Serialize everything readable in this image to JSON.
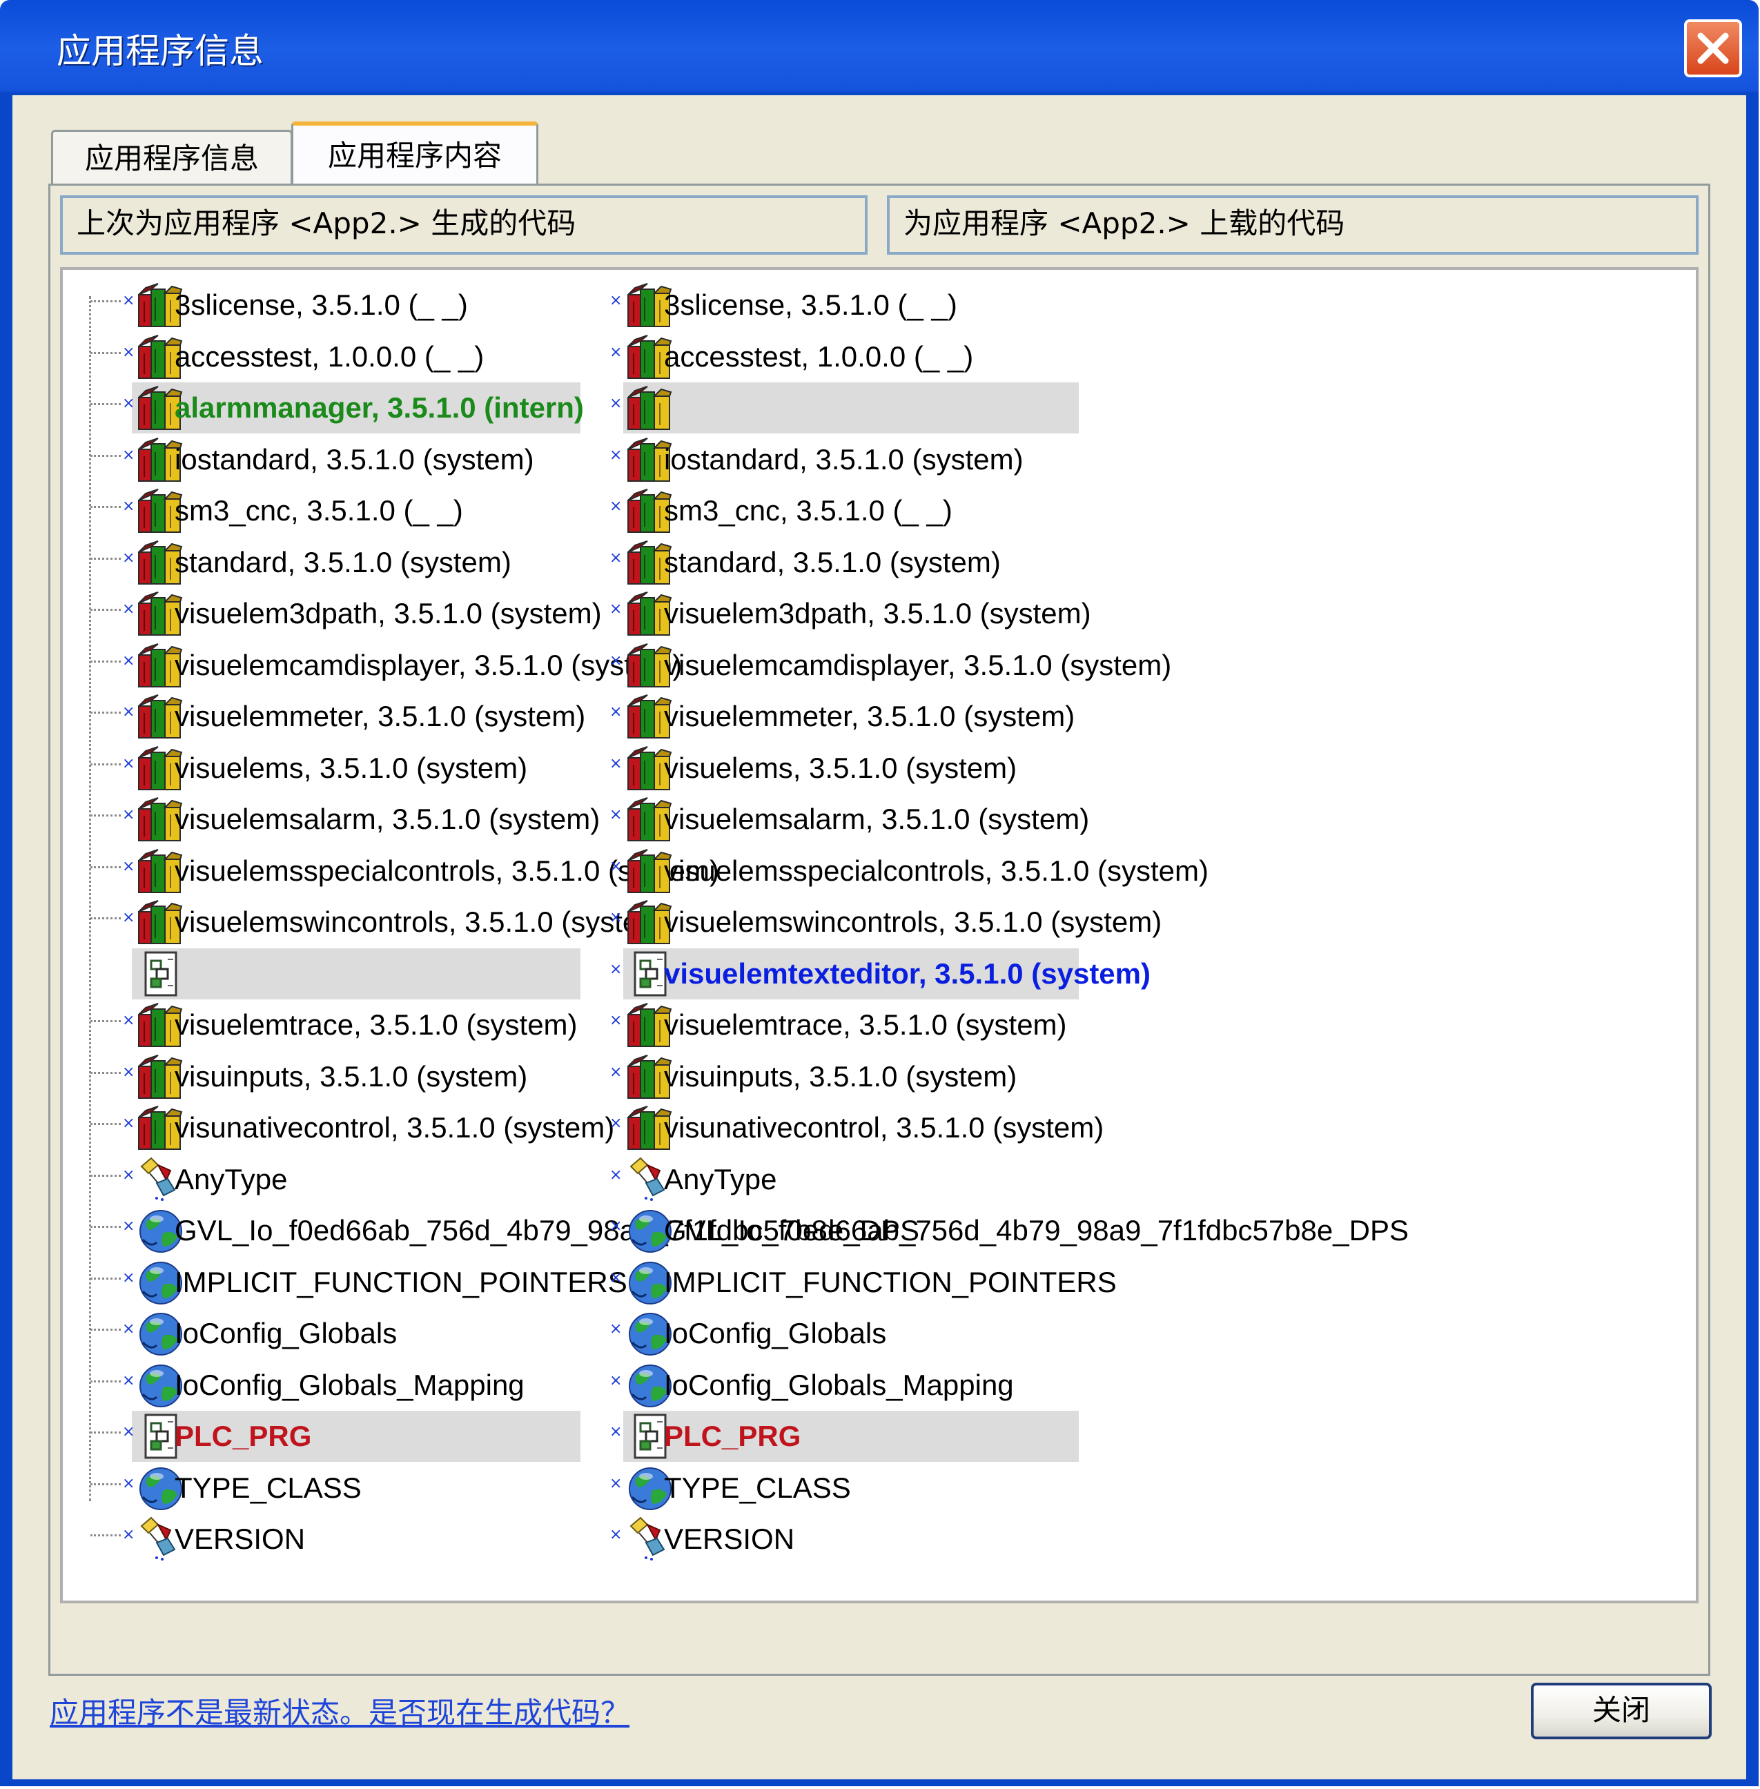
{
  "window": {
    "title": "应用程序信息"
  },
  "tabs": [
    {
      "label": "应用程序信息",
      "active": false
    },
    {
      "label": "应用程序内容",
      "active": true
    }
  ],
  "columns": {
    "left_header": "上次为应用程序 <App2.> 生成的代码",
    "right_header": "为应用程序 <App2.> 上载的代码"
  },
  "rows": [
    {
      "icon": "library-icon",
      "left": "3slicense, 3.5.1.0 (_ _)",
      "right": "3slicense, 3.5.1.0 (_ _)",
      "style": "normal",
      "hl": false
    },
    {
      "icon": "library-icon",
      "left": "accesstest, 1.0.0.0 (_ _)",
      "right": "accesstest, 1.0.0.0 (_ _)",
      "style": "normal",
      "hl": false
    },
    {
      "icon": "library-icon",
      "left": "alarmmanager, 3.5.1.0 (intern)",
      "right": "",
      "style": "green",
      "hl": true
    },
    {
      "icon": "library-icon",
      "left": "iostandard, 3.5.1.0 (system)",
      "right": "iostandard, 3.5.1.0 (system)",
      "style": "normal",
      "hl": false
    },
    {
      "icon": "library-icon",
      "left": "sm3_cnc, 3.5.1.0 (_ _)",
      "right": "sm3_cnc, 3.5.1.0 (_ _)",
      "style": "normal",
      "hl": false
    },
    {
      "icon": "library-icon",
      "left": "standard, 3.5.1.0 (system)",
      "right": "standard, 3.5.1.0 (system)",
      "style": "normal",
      "hl": false
    },
    {
      "icon": "library-icon",
      "left": "visuelem3dpath, 3.5.1.0 (system)",
      "right": "visuelem3dpath, 3.5.1.0 (system)",
      "style": "normal",
      "hl": false
    },
    {
      "icon": "library-icon",
      "left": "visuelemcamdisplayer, 3.5.1.0 (system)",
      "right": "visuelemcamdisplayer, 3.5.1.0 (system)",
      "style": "normal",
      "hl": false
    },
    {
      "icon": "library-icon",
      "left": "visuelemmeter, 3.5.1.0 (system)",
      "right": "visuelemmeter, 3.5.1.0 (system)",
      "style": "normal",
      "hl": false
    },
    {
      "icon": "library-icon",
      "left": "visuelems, 3.5.1.0 (system)",
      "right": "visuelems, 3.5.1.0 (system)",
      "style": "normal",
      "hl": false
    },
    {
      "icon": "library-icon",
      "left": "visuelemsalarm, 3.5.1.0 (system)",
      "right": "visuelemsalarm, 3.5.1.0 (system)",
      "style": "normal",
      "hl": false
    },
    {
      "icon": "library-icon",
      "left": "visuelemsspecialcontrols, 3.5.1.0 (system)",
      "right": "visuelemsspecialcontrols, 3.5.1.0 (system)",
      "style": "normal",
      "hl": false
    },
    {
      "icon": "library-icon",
      "left": "visuelemswincontrols, 3.5.1.0 (system)",
      "right": "visuelemswincontrols, 3.5.1.0 (system)",
      "style": "normal",
      "hl": false
    },
    {
      "icon": "program-icon",
      "left": "",
      "right": "visuelemtexteditor, 3.5.1.0 (system)",
      "style": "blue",
      "hl": true
    },
    {
      "icon": "library-icon",
      "left": "visuelemtrace, 3.5.1.0 (system)",
      "right": "visuelemtrace, 3.5.1.0 (system)",
      "style": "normal",
      "hl": false
    },
    {
      "icon": "library-icon",
      "left": "visuinputs, 3.5.1.0 (system)",
      "right": "visuinputs, 3.5.1.0 (system)",
      "style": "normal",
      "hl": false
    },
    {
      "icon": "library-icon",
      "left": "visunativecontrol, 3.5.1.0 (system)",
      "right": "visunativecontrol, 3.5.1.0 (system)",
      "style": "normal",
      "hl": false
    },
    {
      "icon": "datatype-icon",
      "left": "AnyType",
      "right": "AnyType",
      "style": "normal",
      "hl": false
    },
    {
      "icon": "globe-icon",
      "left": "GVL_Io_f0ed66ab_756d_4b79_98a9_7f1fdbc57b8e_DPS",
      "right": "GVL_Io_f0ed66ab_756d_4b79_98a9_7f1fdbc57b8e_DPS",
      "style": "normal",
      "hl": false
    },
    {
      "icon": "globe-icon",
      "left": "IMPLICIT_FUNCTION_POINTERS",
      "right": "IMPLICIT_FUNCTION_POINTERS",
      "style": "normal",
      "hl": false
    },
    {
      "icon": "globe-icon",
      "left": "IoConfig_Globals",
      "right": "IoConfig_Globals",
      "style": "normal",
      "hl": false
    },
    {
      "icon": "globe-icon",
      "left": "IoConfig_Globals_Mapping",
      "right": "IoConfig_Globals_Mapping",
      "style": "normal",
      "hl": false
    },
    {
      "icon": "program-icon",
      "left": "PLC_PRG",
      "right": "PLC_PRG",
      "style": "red",
      "hl": true
    },
    {
      "icon": "globe-icon",
      "left": "TYPE_CLASS",
      "right": "TYPE_CLASS",
      "style": "normal",
      "hl": false
    },
    {
      "icon": "datatype-icon",
      "left": "VERSION",
      "right": "VERSION",
      "style": "normal",
      "hl": false
    }
  ],
  "footer": {
    "link_text": "应用程序不是最新状态。是否现在生成代码？",
    "close_label": "关闭"
  },
  "colors": {
    "titlebar": "#1553dd",
    "dialog_bg": "#ece9d8",
    "highlight_row": "#dcdcdc",
    "green_text": "#1a8a1a",
    "blue_text": "#0a1ee0",
    "red_text": "#c0141c"
  }
}
